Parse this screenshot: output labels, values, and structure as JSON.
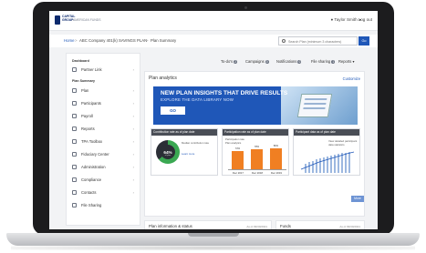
{
  "header": {
    "logo_line1": "CAPITAL",
    "logo_line2": "GROUP",
    "logo_line3": "AMERICAN FUNDS",
    "user_name": "Taylor Smith",
    "logout": "Log out"
  },
  "breadcrumb": {
    "home": "Home",
    "company": "ABC Company 401(k) SAVINGS PLAN",
    "current": "Plan Summary",
    "separator": ">"
  },
  "search": {
    "placeholder": "Search Plan (minimum 3 characters)",
    "go_label": "Go"
  },
  "sidebar": {
    "dashboard_title": "Dashboard",
    "plan_summary_title": "Plan Summary",
    "items": [
      {
        "label": "Partner Link",
        "icon": "link-icon"
      },
      {
        "label": "Plan",
        "icon": "document-icon"
      },
      {
        "label": "Participants",
        "icon": "people-icon"
      },
      {
        "label": "Payroll",
        "icon": "dollar-icon"
      },
      {
        "label": "Reports",
        "icon": "report-icon"
      },
      {
        "label": "TPA Toolbox",
        "icon": "toolbox-icon"
      },
      {
        "label": "Fiduciary Center",
        "icon": "shield-icon"
      },
      {
        "label": "Administration",
        "icon": "gear-icon"
      },
      {
        "label": "Compliance",
        "icon": "check-icon"
      },
      {
        "label": "Contacts",
        "icon": "contact-icon"
      },
      {
        "label": "File Sharing",
        "icon": "share-icon"
      }
    ]
  },
  "tabs": {
    "todo": "To-do's",
    "todo_count": "2",
    "campaigns": "Campaigns",
    "campaigns_count": "0",
    "notifications": "Notifications",
    "notifications_count": "0",
    "file_sharing": "File sharing",
    "file_sharing_count": "1",
    "reports": "Reports"
  },
  "plan_analytics": {
    "title": "Plan analytics",
    "customize": "Customize",
    "banner_title": "NEW PLAN INSIGHTS THAT DRIVE RESULTS",
    "banner_subtitle": "EXPLORE THE DATA LIBRARY NOW",
    "banner_go": "GO",
    "card1_header": "Contribution rate as of plan date",
    "card1_pct": "64%",
    "card1_pct_sub": "of plan",
    "card1_text": "Median contribution rate",
    "card1_link": "Learn more",
    "card2_header": "Participation rate as of plan date",
    "card2_sub1": "Participation rate",
    "card2_sub2": "Plan analytics",
    "card2_bars": [
      {
        "label": "Dec 2017",
        "value": "72%"
      },
      {
        "label": "Dec 2018",
        "value": "78%"
      },
      {
        "label": "Dec 2019",
        "value": "80%"
      }
    ],
    "card3_header": "Participant data as of plan date",
    "card3_text": "View detailed participant data statistics",
    "more_label": "More"
  },
  "lower": {
    "left_title": "Plan information & status",
    "left_date": "As of 09/30/2021",
    "right_title": "Funds",
    "right_date": "As of 09/30/2021"
  },
  "colors": {
    "primary": "#1f57b8",
    "accent_orange": "#f07f22",
    "accent_green": "#3aa852",
    "dark_header": "#4a4e56"
  }
}
